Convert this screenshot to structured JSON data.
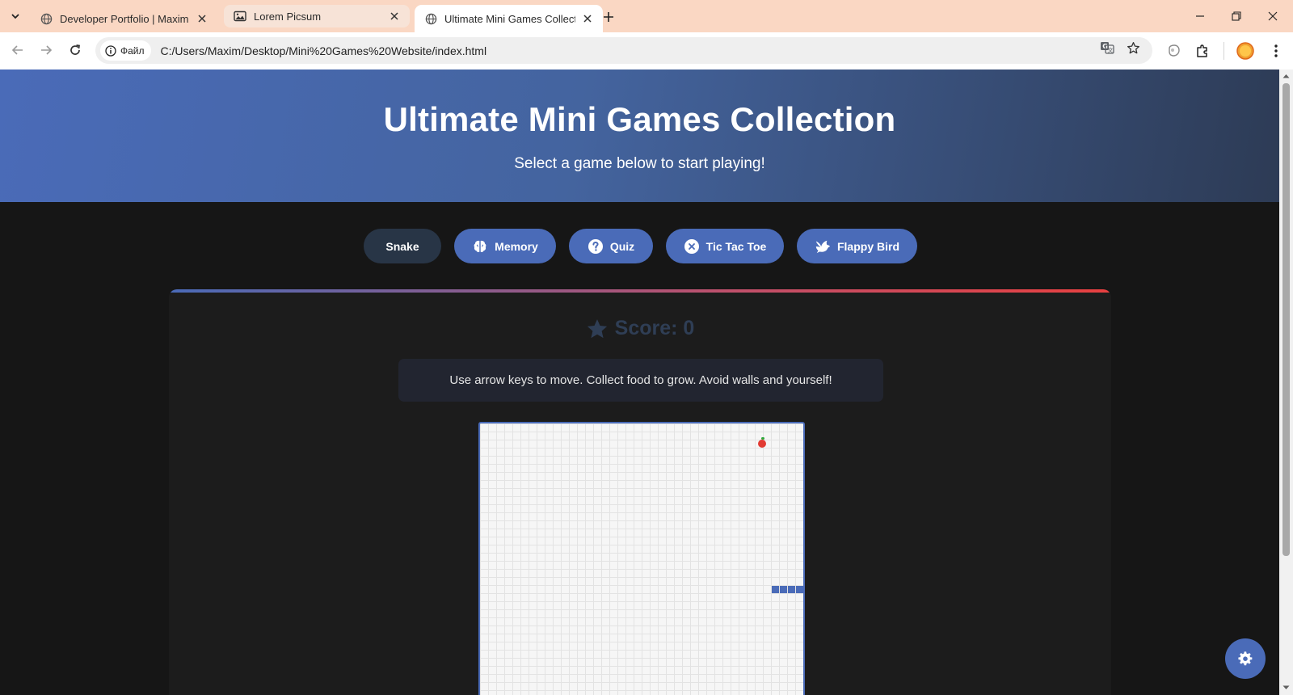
{
  "browser": {
    "tabs": [
      {
        "title": "Developer Portfolio | Maxim Mk",
        "icon": "globe-icon",
        "state": "inactive"
      },
      {
        "title": "Lorem Picsum",
        "icon": "image-icon",
        "state": "inactive"
      },
      {
        "title": "Ultimate Mini Games Collection",
        "icon": "globe-icon",
        "state": "active"
      }
    ],
    "site_chip_label": "Файл",
    "url": "C:/Users/Maxim/Desktop/Mini%20Games%20Website/index.html",
    "colors": {
      "tabbar": "#fad7c3",
      "toolbar": "#ffffff",
      "omnibox": "#efefef"
    }
  },
  "page": {
    "title": "Ultimate Mini Games Collection",
    "subtitle": "Select a game below to start playing!",
    "game_buttons": [
      {
        "label": "Snake",
        "icon": "",
        "active": true
      },
      {
        "label": "Memory",
        "icon": "brain-icon",
        "active": false
      },
      {
        "label": "Quiz",
        "icon": "question-icon",
        "active": false
      },
      {
        "label": "Tic Tac Toe",
        "icon": "x-circle-icon",
        "active": false
      },
      {
        "label": "Flappy Bird",
        "icon": "dove-icon",
        "active": false
      }
    ],
    "score_label": "Score: 0",
    "score_icon": "star-icon",
    "instructions": "Use arrow keys to move. Collect food to grow. Avoid walls and yourself!",
    "colors": {
      "accent": "#4a6bb8",
      "active_button": "#283546",
      "background": "#161616",
      "panel": "#1c1c1c",
      "food": "#e23b33"
    }
  }
}
